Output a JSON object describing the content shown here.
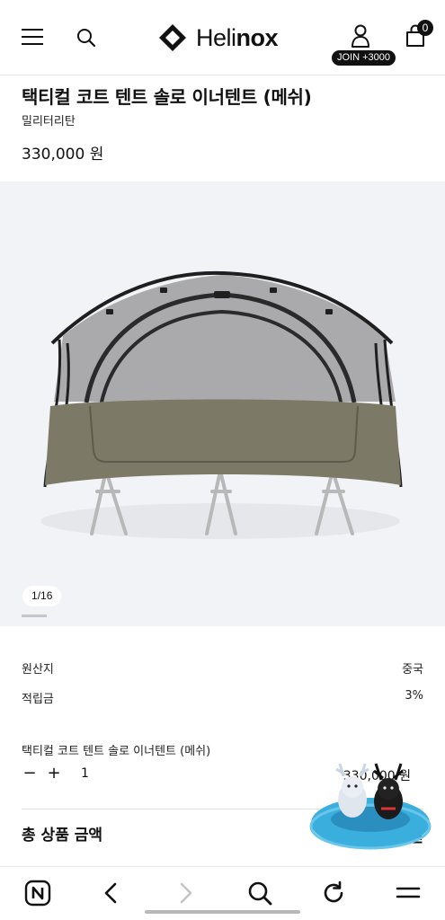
{
  "header": {
    "brand_light": "Heli",
    "brand_bold": "nox",
    "join_badge": "JOIN +3000",
    "cart_count": "0",
    "icons": [
      "menu-icon",
      "search-icon",
      "helinox-logo-mark",
      "user-icon",
      "shopping-bag-icon"
    ]
  },
  "product": {
    "title": "택티컬 코트 텐트 솔로 이너텐트 (메쉬)",
    "color": "밀리터리탄",
    "price": "330,000 원"
  },
  "gallery": {
    "pager_current": "1",
    "pager_sep": "/",
    "pager_total": "16",
    "active_fraction": 0.0625
  },
  "info": [
    {
      "label": "원산지",
      "value": "중국"
    },
    {
      "label": "적립금",
      "value": "3%"
    }
  ],
  "option": {
    "name": "택티컬 코트 텐트 솔로 이너텐트 (메쉬)",
    "minus": "−",
    "plus": "+",
    "quantity": "1",
    "price": "330,000 원"
  },
  "total": {
    "label": "총 상품 금액",
    "suffix": "원"
  },
  "browser_bar": {
    "icons": [
      "naver-home-icon",
      "back-icon",
      "forward-icon",
      "search-icon",
      "refresh-icon",
      "menu-icon"
    ]
  },
  "colors": {
    "text": "#111111",
    "gallery_bg": "#f2f3f6",
    "tent_olive": "#7c7a66",
    "mesh": "#8e8e90",
    "float_ring": "#3aaedc"
  }
}
